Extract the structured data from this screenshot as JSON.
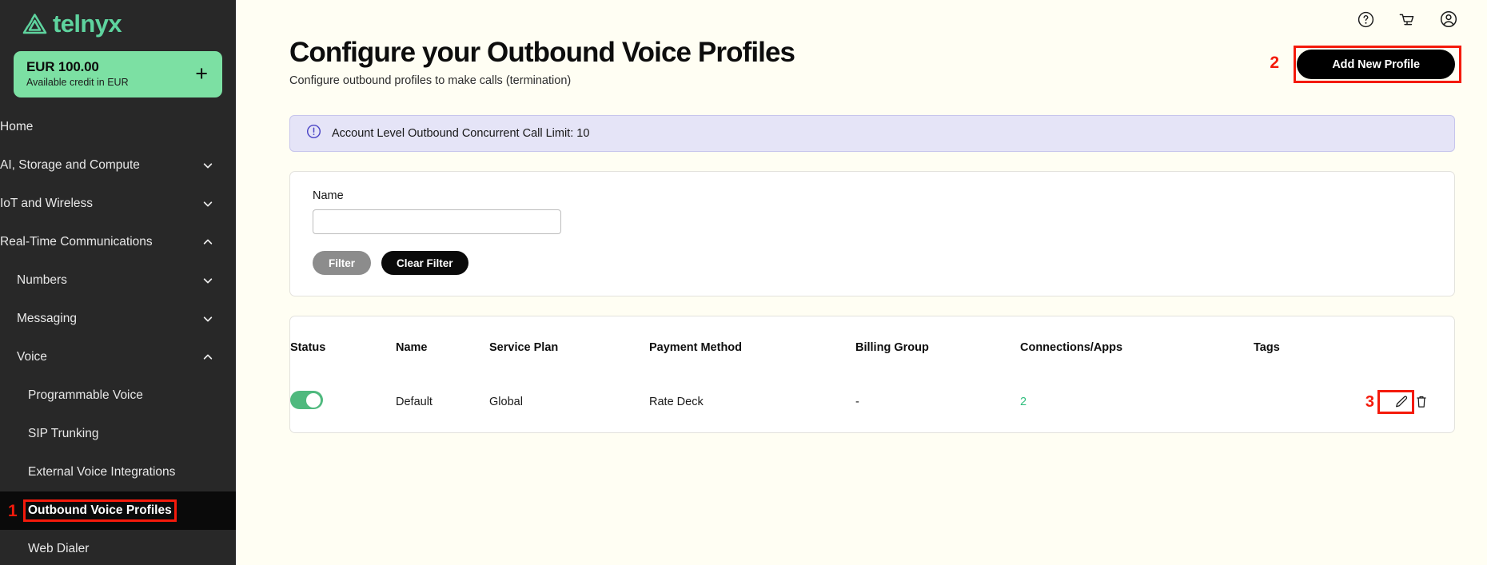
{
  "brand": {
    "name": "telnyx",
    "logo_icon": "telnyx-triangle-logo",
    "accent_green": "#5ED39E",
    "credit_badge_green": "#7CE0A3",
    "annotation_red": "#F41A0B"
  },
  "sidebar": {
    "credit": {
      "amount": "EUR 100.00",
      "caption": "Available credit in EUR",
      "add_icon": "plus-icon"
    },
    "items": [
      {
        "label": "Home",
        "level": 0,
        "chevron": "none",
        "active": false
      },
      {
        "label": "AI, Storage and Compute",
        "level": 0,
        "chevron": "down",
        "active": false
      },
      {
        "label": "IoT and Wireless",
        "level": 0,
        "chevron": "down",
        "active": false
      },
      {
        "label": "Real-Time Communications",
        "level": 0,
        "chevron": "up",
        "active": false
      },
      {
        "label": "Numbers",
        "level": 1,
        "chevron": "down",
        "active": false
      },
      {
        "label": "Messaging",
        "level": 1,
        "chevron": "down",
        "active": false
      },
      {
        "label": "Voice",
        "level": 1,
        "chevron": "up",
        "active": false
      },
      {
        "label": "Programmable Voice",
        "level": 2,
        "chevron": "none",
        "active": false
      },
      {
        "label": "SIP Trunking",
        "level": 2,
        "chevron": "none",
        "active": false
      },
      {
        "label": "External Voice Integrations",
        "level": 2,
        "chevron": "none",
        "active": false
      },
      {
        "label": "Outbound Voice Profiles",
        "level": 2,
        "chevron": "none",
        "active": true
      },
      {
        "label": "Web Dialer",
        "level": 2,
        "chevron": "none",
        "active": false
      }
    ]
  },
  "topbar": {
    "icons": [
      {
        "name": "help-icon"
      },
      {
        "name": "cart-icon"
      },
      {
        "name": "account-icon"
      }
    ]
  },
  "header": {
    "title": "Configure your Outbound Voice Profiles",
    "subtitle": "Configure outbound profiles to make calls (termination)",
    "add_button_label": "Add New Profile"
  },
  "banner": {
    "icon": "info-circle-icon",
    "text": "Account Level Outbound Concurrent Call Limit: 10"
  },
  "filter": {
    "name_label": "Name",
    "name_value": "",
    "name_placeholder": "",
    "filter_label": "Filter",
    "clear_label": "Clear Filter"
  },
  "table": {
    "columns": [
      "Status",
      "Name",
      "Service Plan",
      "Payment Method",
      "Billing Group",
      "Connections/Apps",
      "Tags"
    ],
    "rows": [
      {
        "status_enabled": true,
        "name": "Default",
        "service_plan": "Global",
        "payment_method": "Rate Deck",
        "billing_group": "-",
        "connections_apps": "2",
        "tags": "",
        "edit_icon": "pencil-icon",
        "delete_icon": "trash-icon"
      }
    ]
  },
  "annotations": [
    {
      "number": "1",
      "target": "sidebar-item-outbound-voice-profiles"
    },
    {
      "number": "2",
      "target": "add-new-profile-button"
    },
    {
      "number": "3",
      "target": "row-edit-button"
    }
  ]
}
